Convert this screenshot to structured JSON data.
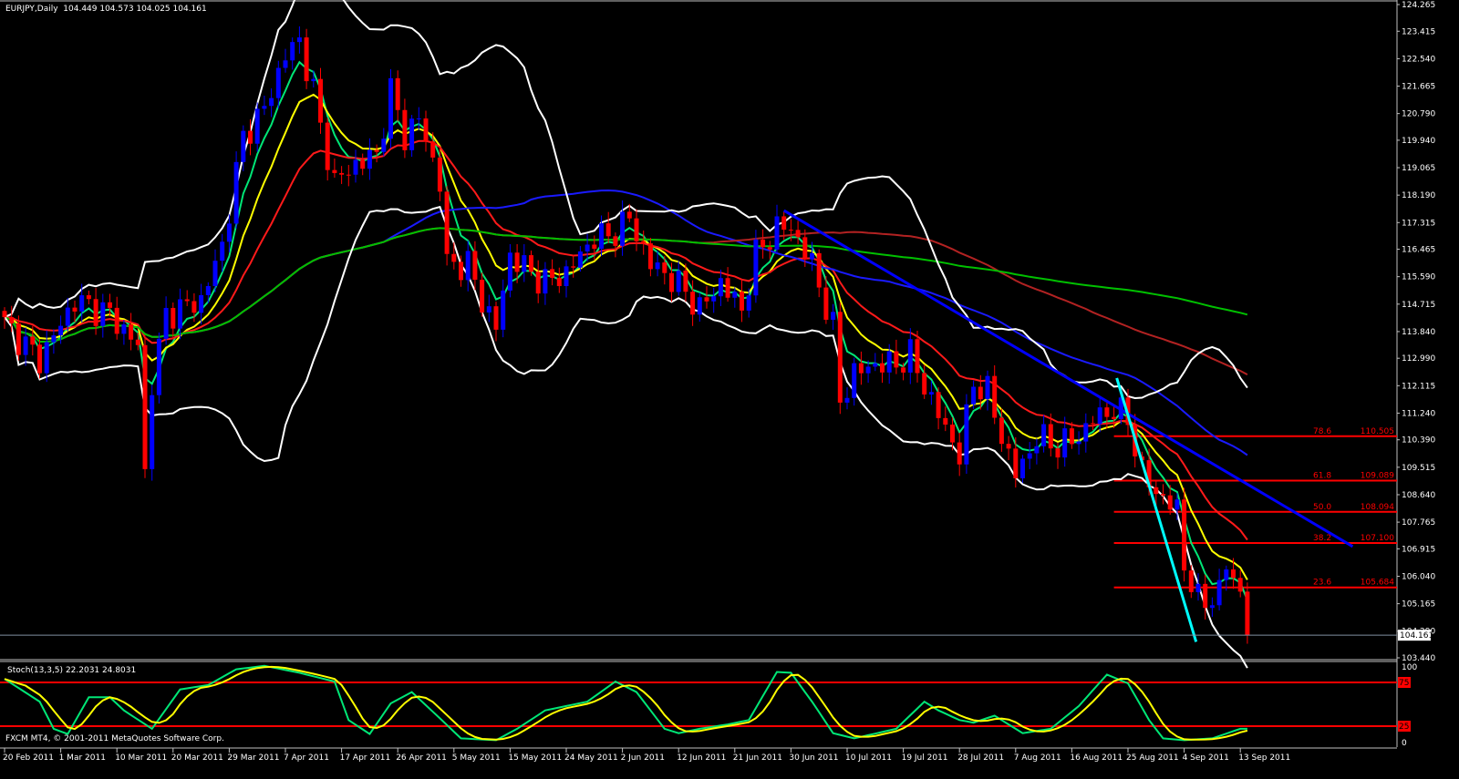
{
  "header": {
    "symbol": "EURJPY,Daily",
    "ohlc": "104.449 104.573 104.025 104.161"
  },
  "footer": {
    "copyright": "FXCM MT4, © 2001-2011 MetaQuotes Software Corp."
  },
  "colors": {
    "bull": "#0000ff",
    "bear": "#ff0000",
    "background": "#000000",
    "axis": "#c0c0c0",
    "ema_fast": "#00e676",
    "ema_mid": "#ffff00",
    "ema_slow": "#ff1a1a",
    "sma_55": "#1a1aff",
    "sma_100": "#b22222",
    "sma_200": "#00c000",
    "bollinger": "#ffffff",
    "trend_blue": "#0000ff",
    "trend_cyan": "#00ffff",
    "fib": "#ff0000",
    "stoch_k": "#00e676",
    "stoch_d": "#ffff00"
  },
  "chart_data": [
    {
      "type": "candlestick",
      "title": "EURJPY,Daily",
      "ylim": [
        103.44,
        124.265
      ],
      "y_ticks": [
        "124.265",
        "123.415",
        "122.540",
        "121.665",
        "120.790",
        "119.940",
        "119.065",
        "118.190",
        "117.315",
        "116.465",
        "115.590",
        "114.715",
        "113.840",
        "112.990",
        "112.115",
        "111.240",
        "110.390",
        "109.515",
        "108.640",
        "107.765",
        "106.915",
        "106.040",
        "105.165",
        "104.290",
        "103.440"
      ],
      "current_price": "104.161",
      "bar_count": 178,
      "x_ticks": [
        "20 Feb 2011",
        "1 Mar 2011",
        "10 Mar 2011",
        "20 Mar 2011",
        "29 Mar 2011",
        "7 Apr 2011",
        "17 Apr 2011",
        "26 Apr 2011",
        "5 May 2011",
        "15 May 2011",
        "24 May 2011",
        "2 Jun 2011",
        "12 Jun 2011",
        "21 Jun 2011",
        "30 Jun 2011",
        "10 Jul 2011",
        "19 Jul 2011",
        "28 Jul 2011",
        "7 Aug 2011",
        "16 Aug 2011",
        "25 Aug 2011",
        "4 Sep 2011",
        "13 Sep 2011"
      ],
      "x_tick_every_bars": 8,
      "close_keyframes": [
        [
          0,
          114.1
        ],
        [
          5,
          112.94
        ],
        [
          10,
          114.83
        ],
        [
          15,
          114.39
        ],
        [
          19,
          113.38
        ],
        [
          20,
          109.31
        ],
        [
          21,
          112.22
        ],
        [
          23,
          114.39
        ],
        [
          28,
          114.83
        ],
        [
          31,
          116.57
        ],
        [
          34,
          120.06
        ],
        [
          37,
          120.93
        ],
        [
          40,
          122.67
        ],
        [
          42,
          123.1
        ],
        [
          44,
          121.51
        ],
        [
          45,
          120.35
        ],
        [
          47,
          118.6
        ],
        [
          50,
          119.18
        ],
        [
          53,
          119.47
        ],
        [
          55,
          121.51
        ],
        [
          57,
          120.06
        ],
        [
          59,
          120.64
        ],
        [
          62,
          118.6
        ],
        [
          63,
          115.99
        ],
        [
          66,
          115.99
        ],
        [
          68,
          114.83
        ],
        [
          70,
          113.96
        ],
        [
          72,
          116.28
        ],
        [
          75,
          115.7
        ],
        [
          77,
          115.41
        ],
        [
          80,
          115.7
        ],
        [
          84,
          116.86
        ],
        [
          86,
          116.86
        ],
        [
          89,
          117.44
        ],
        [
          92,
          115.99
        ],
        [
          94,
          115.7
        ],
        [
          97,
          115.12
        ],
        [
          99,
          114.54
        ],
        [
          102,
          115.41
        ],
        [
          105,
          114.54
        ],
        [
          107,
          116.28
        ],
        [
          110,
          117.15
        ],
        [
          112,
          117.15
        ],
        [
          115,
          115.99
        ],
        [
          118,
          113.96
        ],
        [
          119,
          111.64
        ],
        [
          121,
          112.51
        ],
        [
          124,
          112.8
        ],
        [
          127,
          112.8
        ],
        [
          129,
          113.09
        ],
        [
          132,
          111.64
        ],
        [
          134,
          110.77
        ],
        [
          136,
          109.89
        ],
        [
          138,
          112.22
        ],
        [
          140,
          111.93
        ],
        [
          142,
          110.48
        ],
        [
          144,
          109.31
        ],
        [
          145,
          109.6
        ],
        [
          147,
          110.48
        ],
        [
          150,
          110.19
        ],
        [
          153,
          110.48
        ],
        [
          155,
          111.06
        ],
        [
          158,
          111.35
        ],
        [
          160,
          111.06
        ],
        [
          162,
          109.31
        ],
        [
          164,
          108.73
        ],
        [
          167,
          108.15
        ],
        [
          168,
          106.41
        ],
        [
          170,
          105.25
        ],
        [
          171,
          105.25
        ],
        [
          173,
          105.54
        ],
        [
          174,
          106.41
        ],
        [
          176,
          105.54
        ],
        [
          177,
          104.16
        ]
      ],
      "indicators": [
        {
          "name": "EMA 5",
          "color_key": "ema_fast",
          "kind": "ema",
          "period": 5
        },
        {
          "name": "EMA 10",
          "color_key": "ema_mid",
          "kind": "ema",
          "period": 10
        },
        {
          "name": "EMA 21",
          "color_key": "ema_slow",
          "kind": "ema",
          "period": 21
        },
        {
          "name": "SMA 55",
          "color_key": "sma_55",
          "kind": "sma",
          "period": 55
        },
        {
          "name": "SMA 100",
          "color_key": "sma_100",
          "kind": "sma",
          "period": 100
        },
        {
          "name": "SMA 200",
          "color_key": "sma_200",
          "kind": "sma",
          "period": 200
        },
        {
          "name": "Bollinger 20,2",
          "color_key": "bollinger",
          "kind": "bb",
          "period": 20
        }
      ],
      "trendlines": [
        {
          "name": "blue-trendline",
          "color_key": "trend_blue",
          "from": [
            111,
            117.7
          ],
          "to": [
            192,
            106.99
          ]
        },
        {
          "name": "cyan-trendline",
          "color_key": "trend_cyan",
          "from": [
            158.4,
            112.36
          ],
          "to": [
            169.7,
            103.95
          ]
        }
      ],
      "fibonacci": {
        "from_bar": 158,
        "levels": [
          {
            "ratio": "78.6",
            "price": "110.505"
          },
          {
            "ratio": "61.8",
            "price": "109.089"
          },
          {
            "ratio": "50.0",
            "price": "108.094"
          },
          {
            "ratio": "38.2",
            "price": "107.100"
          },
          {
            "ratio": "23.6",
            "price": "105.684"
          }
        ]
      }
    },
    {
      "type": "line",
      "title": "Stoch(13,3,5)",
      "values_label": "22.2031 24.8031",
      "ylim": [
        0,
        100
      ],
      "y_ticks": [
        "100",
        "0"
      ],
      "levels": [
        "75",
        "25"
      ],
      "k_keyframes": [
        [
          0,
          79
        ],
        [
          5,
          53
        ],
        [
          7,
          22
        ],
        [
          9,
          16
        ],
        [
          12,
          58
        ],
        [
          15,
          58
        ],
        [
          17,
          43
        ],
        [
          21,
          22
        ],
        [
          25,
          67
        ],
        [
          29,
          72
        ],
        [
          33,
          90
        ],
        [
          37,
          94
        ],
        [
          42,
          86
        ],
        [
          47,
          76
        ],
        [
          49,
          32
        ],
        [
          52,
          16
        ],
        [
          55,
          51
        ],
        [
          58,
          64
        ],
        [
          62,
          34
        ],
        [
          65,
          11
        ],
        [
          70,
          9
        ],
        [
          73,
          22
        ],
        [
          77,
          43
        ],
        [
          83,
          53
        ],
        [
          87,
          76
        ],
        [
          90,
          64
        ],
        [
          94,
          22
        ],
        [
          96,
          17
        ],
        [
          99,
          22
        ],
        [
          103,
          27
        ],
        [
          106,
          32
        ],
        [
          110,
          87
        ],
        [
          112,
          86
        ],
        [
          115,
          53
        ],
        [
          118,
          17
        ],
        [
          121,
          11
        ],
        [
          127,
          22
        ],
        [
          131,
          53
        ],
        [
          133,
          43
        ],
        [
          136,
          32
        ],
        [
          138,
          29
        ],
        [
          141,
          37
        ],
        [
          145,
          17
        ],
        [
          149,
          22
        ],
        [
          153,
          48
        ],
        [
          157,
          84
        ],
        [
          160,
          74
        ],
        [
          163,
          32
        ],
        [
          165,
          11
        ],
        [
          168,
          9
        ],
        [
          172,
          11
        ],
        [
          176,
          22
        ],
        [
          177,
          22
        ]
      ]
    }
  ]
}
